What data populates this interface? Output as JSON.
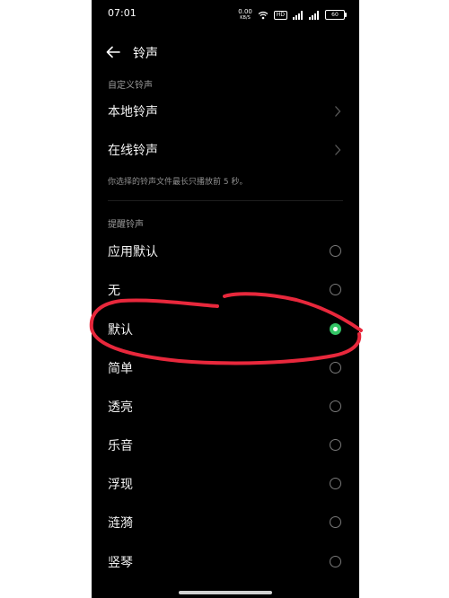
{
  "status_bar": {
    "time": "07:01",
    "net_speed_value": "0.00",
    "net_speed_unit": "KB/S",
    "hd_badge": "HD",
    "battery_level": "60"
  },
  "header": {
    "back_icon": "arrow-left-icon",
    "title": "铃声"
  },
  "custom_section": {
    "header": "自定义铃声",
    "items": [
      {
        "label": "本地铃声",
        "icon": "chevron-right-icon"
      },
      {
        "label": "在线铃声",
        "icon": "chevron-right-icon"
      }
    ],
    "note": "你选择的铃声文件最长只播放前 5 秒。"
  },
  "alert_section": {
    "header": "提醒铃声",
    "items": [
      {
        "label": "应用默认",
        "selected": false
      },
      {
        "label": "无",
        "selected": false
      },
      {
        "label": "默认",
        "selected": true
      },
      {
        "label": "简单",
        "selected": false
      },
      {
        "label": "透亮",
        "selected": false
      },
      {
        "label": "乐音",
        "selected": false
      },
      {
        "label": "浮现",
        "selected": false
      },
      {
        "label": "涟漪",
        "selected": false
      },
      {
        "label": "竖琴",
        "selected": false
      }
    ]
  },
  "colors": {
    "background": "#000000",
    "selected_radio": "#33c465",
    "annotation_stroke": "#e8283c"
  }
}
